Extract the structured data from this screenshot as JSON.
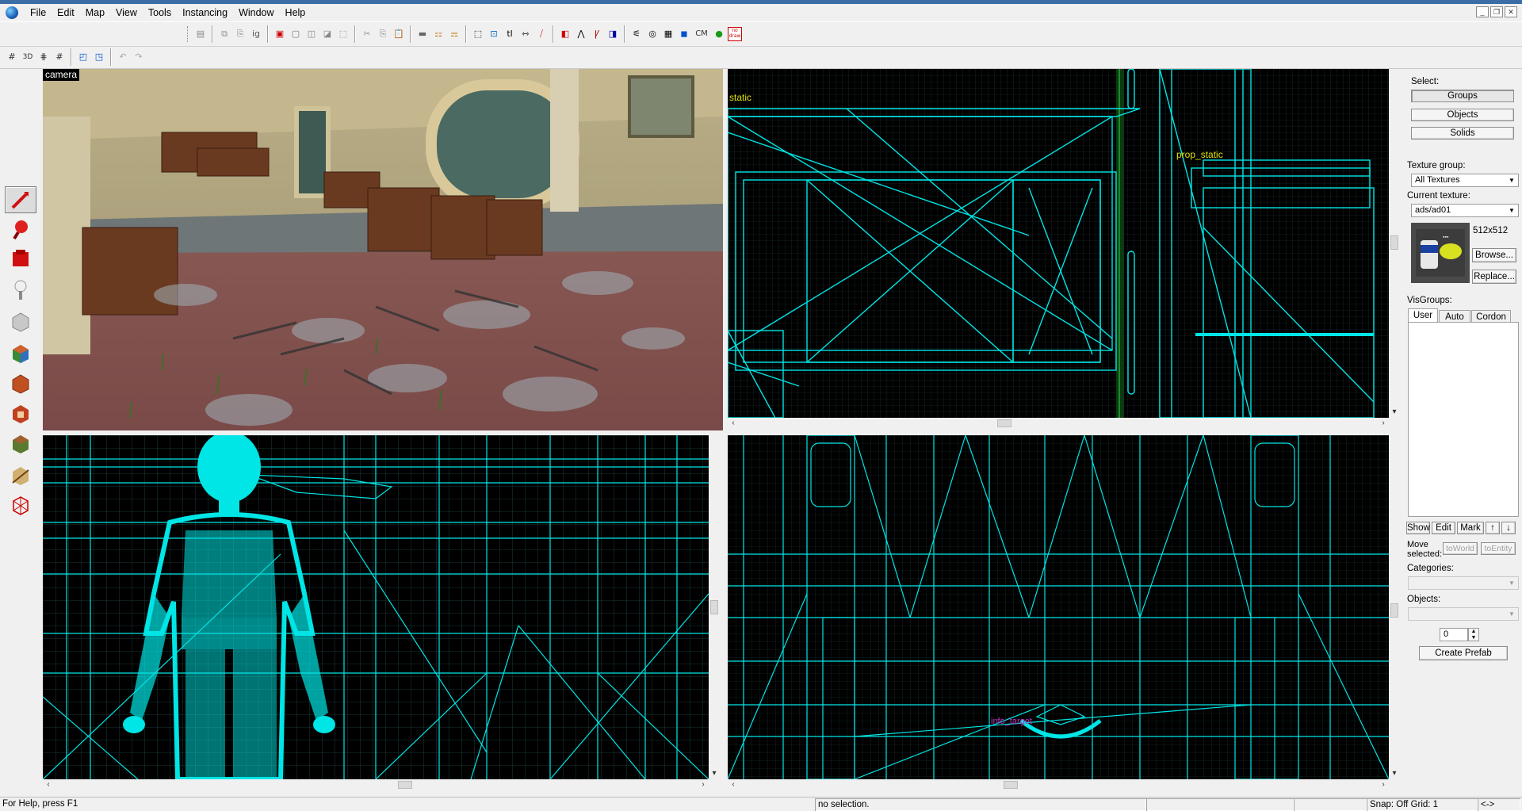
{
  "menu": {
    "items": [
      "File",
      "Edit",
      "Map",
      "View",
      "Tools",
      "Instancing",
      "Window",
      "Help"
    ]
  },
  "toolbar": {
    "cm_label": "CM",
    "nodraw_label": "no draw",
    "undo_icon": "undo-icon",
    "redo_icon": "redo-icon"
  },
  "viewports": {
    "camera_label": "camera",
    "top_right_labels": [
      "static",
      "prop_static"
    ],
    "bottom_right_label": "info_target"
  },
  "right_panel": {
    "select_label": "Select:",
    "select_buttons": [
      "Groups",
      "Objects",
      "Solids"
    ],
    "texture_group_label": "Texture group:",
    "texture_group_value": "All Textures",
    "current_texture_label": "Current texture:",
    "current_texture_value": "ads/ad01",
    "texture_size": "512x512",
    "browse_label": "Browse...",
    "replace_label": "Replace...",
    "visgroups_label": "VisGroups:",
    "visgroup_tabs": [
      "User",
      "Auto",
      "Cordon"
    ],
    "visgroup_buttons": [
      "Show",
      "Edit",
      "Mark"
    ],
    "move_selected_label": "Move\nselected:",
    "to_world_label": "toWorld",
    "to_entity_label": "toEntity",
    "categories_label": "Categories:",
    "objects_label": "Objects:",
    "prefab_count": "0",
    "create_prefab_label": "Create Prefab"
  },
  "status": {
    "help": "For Help, press F1",
    "selection": "no selection.",
    "snap": "Snap: Off Grid: 1",
    "arrows": "<->"
  },
  "colors": {
    "wire": "#00e5e5",
    "grid": "#1f3f3f",
    "entity_label": "#e0e000",
    "info_label": "#c030c0",
    "menu_bg": "#f0f0f0"
  }
}
